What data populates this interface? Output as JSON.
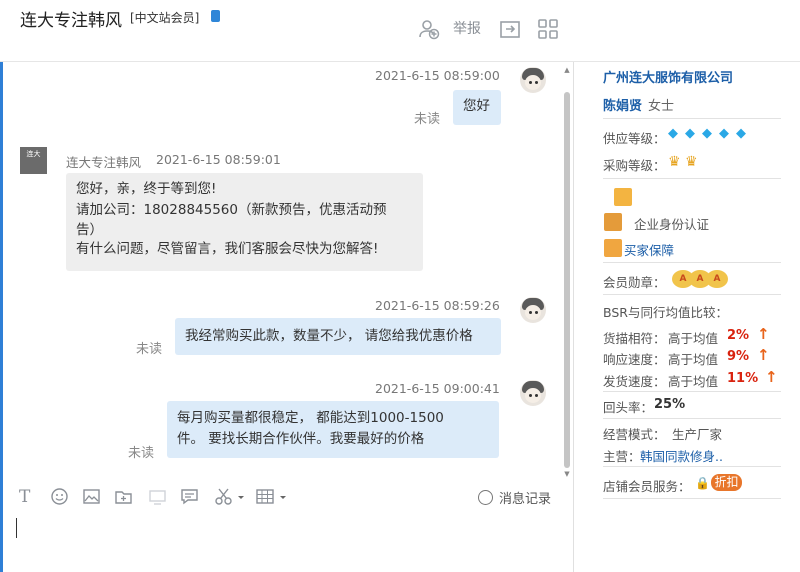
{
  "header": {
    "title": "连大专注韩风",
    "site_tag": "[中文站会员]",
    "report_label": "举报",
    "icons": [
      "add-contact-icon",
      "report-label",
      "share-icon",
      "apps-grid-icon"
    ]
  },
  "messages": [
    {
      "id": "m1",
      "direction": "out",
      "time": "2021-6-15 08:59:00",
      "status": "未读",
      "lines": [
        "您好"
      ]
    },
    {
      "id": "m2",
      "direction": "in",
      "sender": "连大专注韩风",
      "time": "2021-6-15 08:59:01",
      "lines": [
        "您好，亲，终于等到您!",
        "请加公司：18028845560（新款预告，优惠活动预",
        "告）",
        "有什么问题，尽管留言，我们客服会尽快为您解答!"
      ]
    },
    {
      "id": "m3",
      "direction": "out",
      "time": "2021-6-15 08:59:26",
      "status": "未读",
      "lines": [
        "我经常购买此款，数量不少， 请您给我优惠价格"
      ]
    },
    {
      "id": "m4",
      "direction": "out",
      "time": "2021-6-15 09:00:41",
      "status": "未读",
      "lines": [
        "每月购买量都很稳定， 都能达到1000-1500",
        "件。 要找长期合作伙伴。我要最好的价格"
      ]
    }
  ],
  "shop_avatar_text": "连大",
  "toolbar": {
    "history_label": "消息记录"
  },
  "panel": {
    "company": "广州连大服饰有限公司",
    "contact_name": "陈娟贤",
    "contact_gender": "女士",
    "supply_label": "供应等级：",
    "supply_level": 5,
    "purchase_label": "采购等级：",
    "purchase_level": 2,
    "cert_label": "企业身份认证",
    "guarantee_label": "买家保障",
    "member_badge_label": "会员勋章：",
    "bsr_label": "BSR与同行均值比较：",
    "metrics": [
      {
        "label": "货描相符：",
        "compare": "高于均值",
        "value": "2%"
      },
      {
        "label": "响应速度：",
        "compare": "高于均值",
        "value": "9%"
      },
      {
        "label": "发货速度：",
        "compare": "高于均值",
        "value": "11%"
      }
    ],
    "repeat_label": "回头率：",
    "repeat_value": "25%",
    "mode_label": "经营模式：",
    "mode_value": "生产厂家",
    "main_label": "主营：",
    "main_value": "韩国同款修身..",
    "service_label": "店铺会员服务：",
    "discount_label": "折扣",
    "colors": {
      "accent_blue": "#1d5fa8",
      "percent_red": "#d9230f",
      "arrow_orange": "#e8641b",
      "bubble_out": "#dcebf9",
      "bubble_in": "#eeeeee"
    }
  }
}
